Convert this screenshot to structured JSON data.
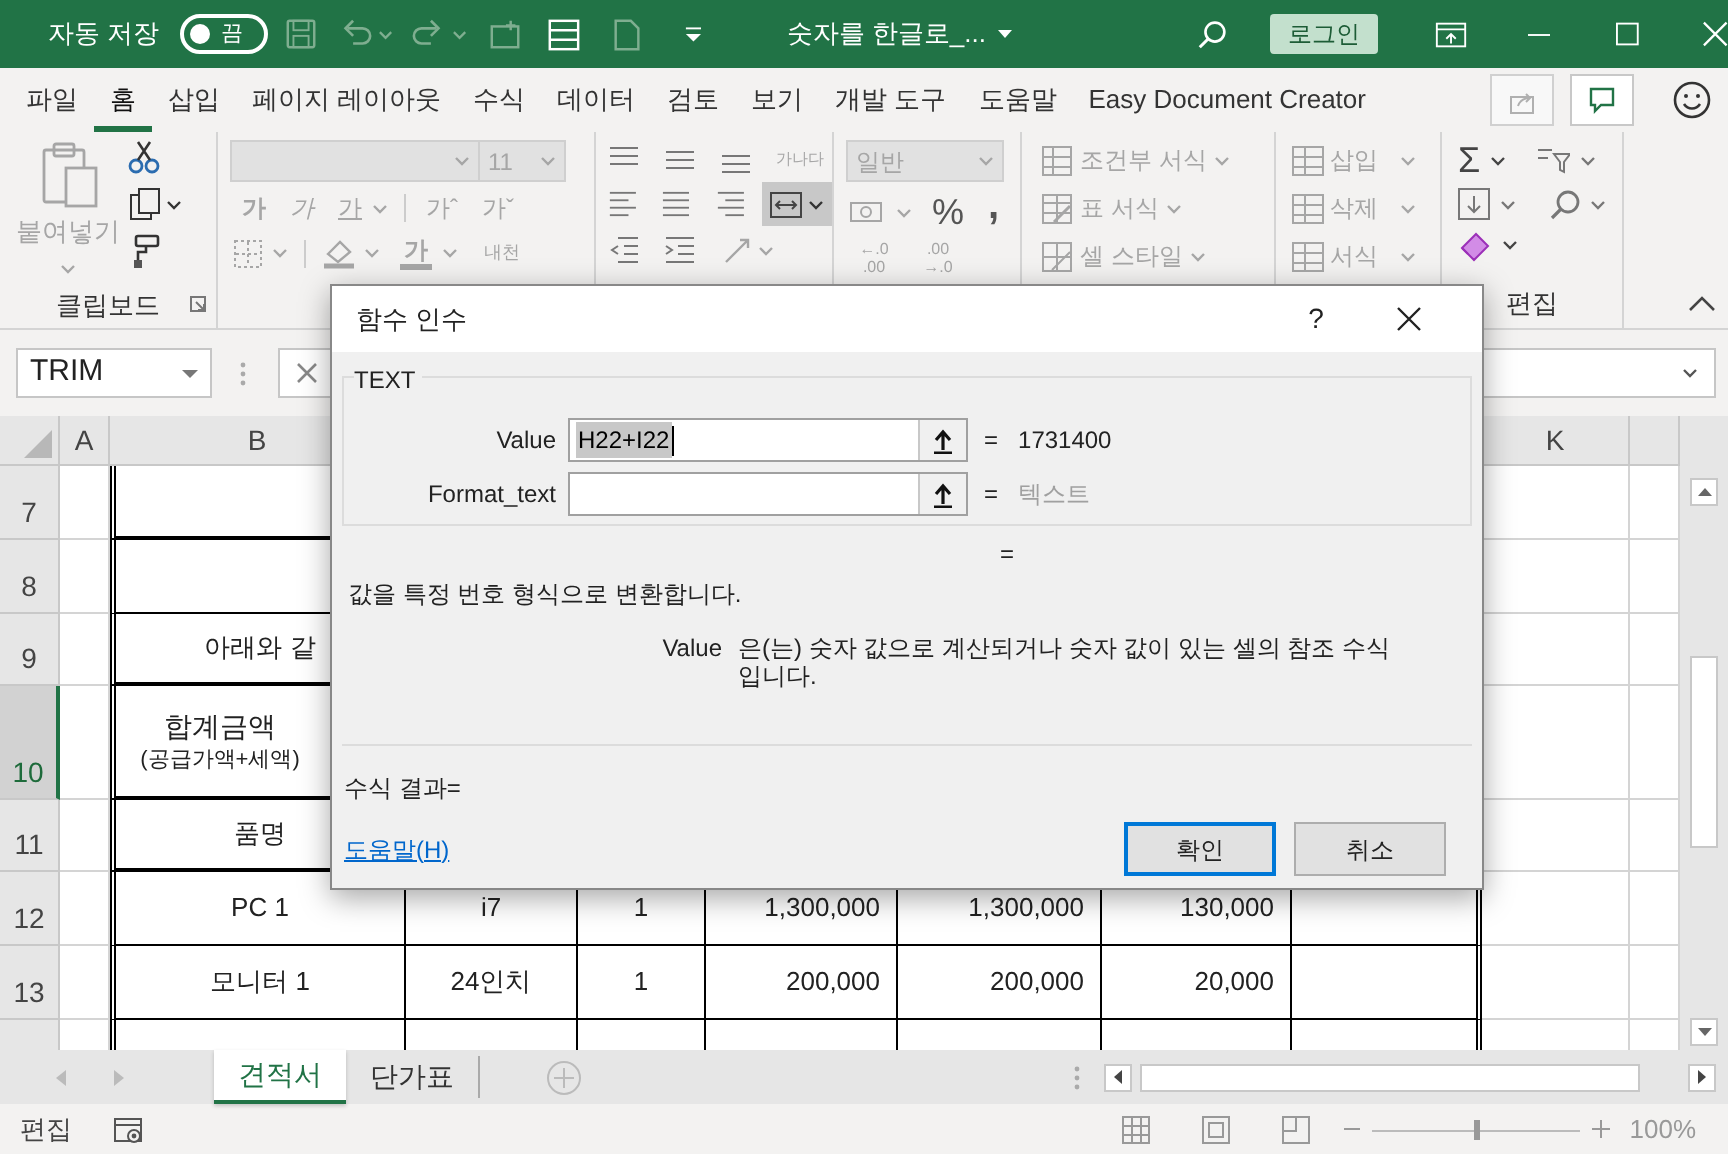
{
  "title_bar": {
    "autosave_label": "자동 저장",
    "autosave_toggle": {
      "label": "끔",
      "on": false
    },
    "document_title": "숫자를 한글로_...",
    "login_button": "로그인"
  },
  "menu_tabs": [
    {
      "label": "파일",
      "selected": false
    },
    {
      "label": "홈",
      "selected": true
    },
    {
      "label": "삽입",
      "selected": false
    },
    {
      "label": "페이지 레이아웃",
      "selected": false
    },
    {
      "label": "수식",
      "selected": false
    },
    {
      "label": "데이터",
      "selected": false
    },
    {
      "label": "검토",
      "selected": false
    },
    {
      "label": "보기",
      "selected": false
    },
    {
      "label": "개발 도구",
      "selected": false
    },
    {
      "label": "도움말",
      "selected": false
    },
    {
      "label": "Easy Document Creator",
      "selected": false
    }
  ],
  "ribbon": {
    "clipboard": {
      "paste_label": "붙여넣기",
      "group_label": "클립보드"
    },
    "font": {
      "font_size": "11",
      "style_buttons": [
        {
          "label": "가",
          "kind": "bold"
        },
        {
          "label": "가",
          "kind": "italic"
        },
        {
          "label": "가",
          "kind": "underline"
        }
      ],
      "size_buttons": [
        "가ˆ",
        "가ˇ"
      ],
      "font_color_label": "가",
      "phonetic_label": "내천"
    },
    "alignment": {
      "wrap_text_label": "가나다"
    },
    "number": {
      "format": "일반",
      "percent": "%",
      "comma": ",",
      "increase_decimal": [
        "←.0",
        ".00"
      ],
      "decrease_decimal": [
        ".00",
        "→.0"
      ]
    },
    "styles": [
      "조건부 서식",
      "표 서식",
      "셀 스타일"
    ],
    "cells": [
      "삽입",
      "삭제",
      "서식"
    ],
    "editing": {
      "autosum": "Σ",
      "group_label": "편집"
    }
  },
  "formula_bar": {
    "name_box": "TRIM"
  },
  "sheet": {
    "column_headers": [
      "A",
      "B",
      "K"
    ],
    "rows": [
      {
        "number": "7",
        "selected": false,
        "cells": []
      },
      {
        "number": "8",
        "selected": false,
        "cells": []
      },
      {
        "number": "9",
        "selected": false,
        "cells": [
          [
            "아래와 같"
          ]
        ]
      },
      {
        "number": "10",
        "selected": true,
        "cells": [
          [
            "합계금액",
            "(공급가액+세액)"
          ]
        ]
      },
      {
        "number": "11",
        "selected": false,
        "cells": [
          [
            "품명"
          ]
        ]
      },
      {
        "number": "12",
        "selected": false,
        "cells": [
          [
            "PC 1"
          ],
          [
            "i7"
          ],
          [
            "1"
          ],
          [
            "1,300,000"
          ],
          [
            "1,300,000"
          ],
          [
            "130,000"
          ]
        ]
      },
      {
        "number": "13",
        "selected": false,
        "cells": [
          [
            "모니터 1"
          ],
          [
            "24인치"
          ],
          [
            "1"
          ],
          [
            "200,000"
          ],
          [
            "200,000"
          ],
          [
            "20,000"
          ]
        ]
      }
    ]
  },
  "sheet_tabs": [
    {
      "label": "견적서",
      "selected": true
    },
    {
      "label": "단가표",
      "selected": false
    }
  ],
  "status_bar": {
    "mode": "편집",
    "zoom": {
      "level": 0.5,
      "reading": "100%"
    }
  },
  "dialog": {
    "title": "함수 인수",
    "help_button": "?",
    "function_name": "TEXT",
    "arguments": [
      {
        "label": "Value",
        "value": "H22+I22",
        "highlighted": true,
        "equals": "=",
        "result": "1731400",
        "greyed": false
      },
      {
        "label": "Format_text",
        "equals": "=",
        "result": "텍스트",
        "greyed": true
      }
    ],
    "result_equals": "=",
    "description": "값을 특정 번호 형식으로 변환합니다.",
    "argument_help": {
      "name": "Value",
      "text": "은(는) 숫자 값으로 계산되거나 숫자 값이 있는 셀의 참조 수식입니다."
    },
    "formula_result_label": "수식 결과=",
    "help_link": "도움말(H)",
    "buttons": [
      {
        "label": "확인",
        "default": true
      },
      {
        "label": "취소",
        "default": false
      }
    ]
  }
}
